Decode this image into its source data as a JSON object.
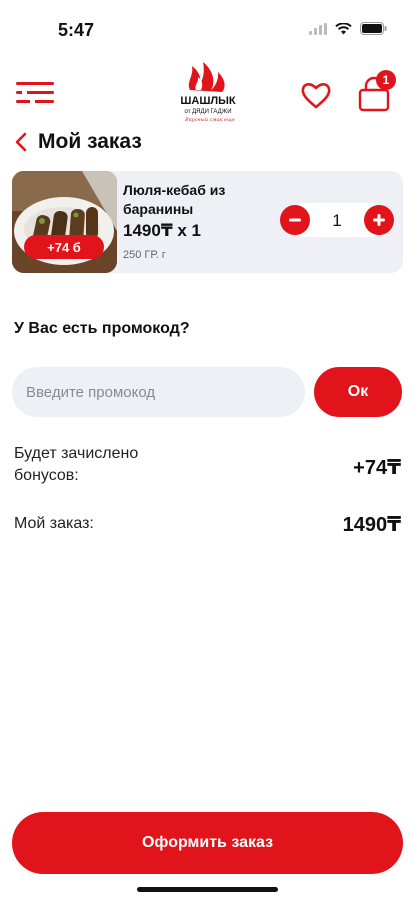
{
  "status": {
    "time": "5:47"
  },
  "header": {
    "logo_line1": "ШАШЛЫК",
    "logo_line2": "от ДЯДИ ГАДЖИ",
    "logo_tagline": "Вкусный смак еще",
    "cart_count": "1"
  },
  "page": {
    "title": "Мой заказ"
  },
  "order_item": {
    "name": "Люля-кебаб из баранины",
    "price": "1490₸ x 1",
    "weight": "250 ГР. г",
    "bonus": "+74 б",
    "quantity": "1"
  },
  "promo": {
    "question": "У Вас есть промокод?",
    "placeholder": "Введите промокод",
    "ok_label": "Ок"
  },
  "summary": {
    "bonus_label": "Будет зачислено бонусов:",
    "bonus_value": "+74₸",
    "order_label": "Мой заказ:",
    "order_value": "1490₸"
  },
  "checkout": {
    "label": "Оформить заказ"
  },
  "colors": {
    "accent": "#e1141c",
    "card_bg": "#eff0f6"
  }
}
